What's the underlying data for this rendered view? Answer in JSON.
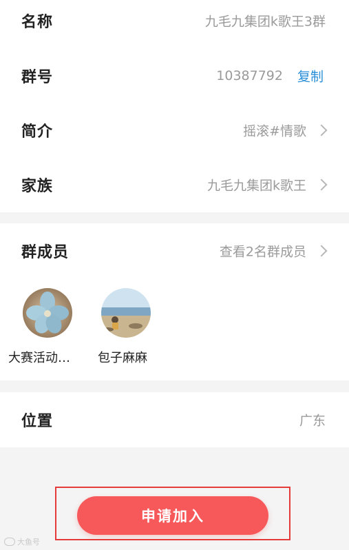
{
  "info": {
    "name_label": "名称",
    "name_value": "九毛九集团k歌王3群",
    "group_id_label": "群号",
    "group_id_value": "10387792",
    "copy_label": "复制",
    "intro_label": "简介",
    "intro_value": "摇滚#情歌",
    "family_label": "家族",
    "family_value": "九毛九集团k歌王"
  },
  "members": {
    "label": "群成员",
    "view_text": "查看2名群成员",
    "list": [
      {
        "name": "大赛活动…",
        "icon": "flower-avatar"
      },
      {
        "name": "包子麻麻",
        "icon": "beach-avatar"
      }
    ]
  },
  "location": {
    "label": "位置",
    "value": "广东"
  },
  "join_button": {
    "label": "申请加入"
  },
  "watermark": "大鱼号"
}
